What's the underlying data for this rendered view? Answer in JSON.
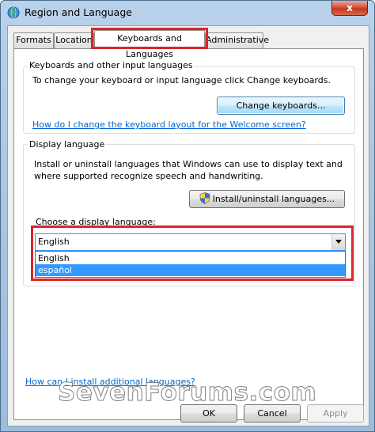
{
  "window": {
    "title": "Region and Language",
    "close_glyph": "x",
    "title_icon": "globe-icon"
  },
  "tabs": [
    {
      "label": "Formats",
      "active": false
    },
    {
      "label": "Location",
      "active": false
    },
    {
      "label": "Keyboards and Languages",
      "active": true
    },
    {
      "label": "Administrative",
      "active": false
    }
  ],
  "keyboards_group": {
    "title": "Keyboards and other input languages",
    "description": "To change your keyboard or input language click Change keyboards.",
    "button_label": "Change keyboards...",
    "help_link": "How do I change the keyboard layout for the Welcome screen?"
  },
  "display_group": {
    "title": "Display language",
    "description_line1": "Install or uninstall languages that Windows can use to display text and",
    "description_line2": "where supported recognize speech and handwriting.",
    "install_button_label": "Install/uninstall languages...",
    "install_button_icon": "uac-shield-icon",
    "choose_label": "Choose a display language:",
    "select": {
      "value": "English",
      "options": [
        "English",
        "español"
      ],
      "highlighted_option": "español"
    }
  },
  "bottom_link": "How can I install additional languages?",
  "footer": {
    "ok_label": "OK",
    "cancel_label": "Cancel",
    "apply_label": "Apply"
  },
  "watermark": "SevenForums.com",
  "colors": {
    "highlight_red": "#d9262b",
    "link_blue": "#0066cc",
    "selection_blue": "#3399ff"
  }
}
